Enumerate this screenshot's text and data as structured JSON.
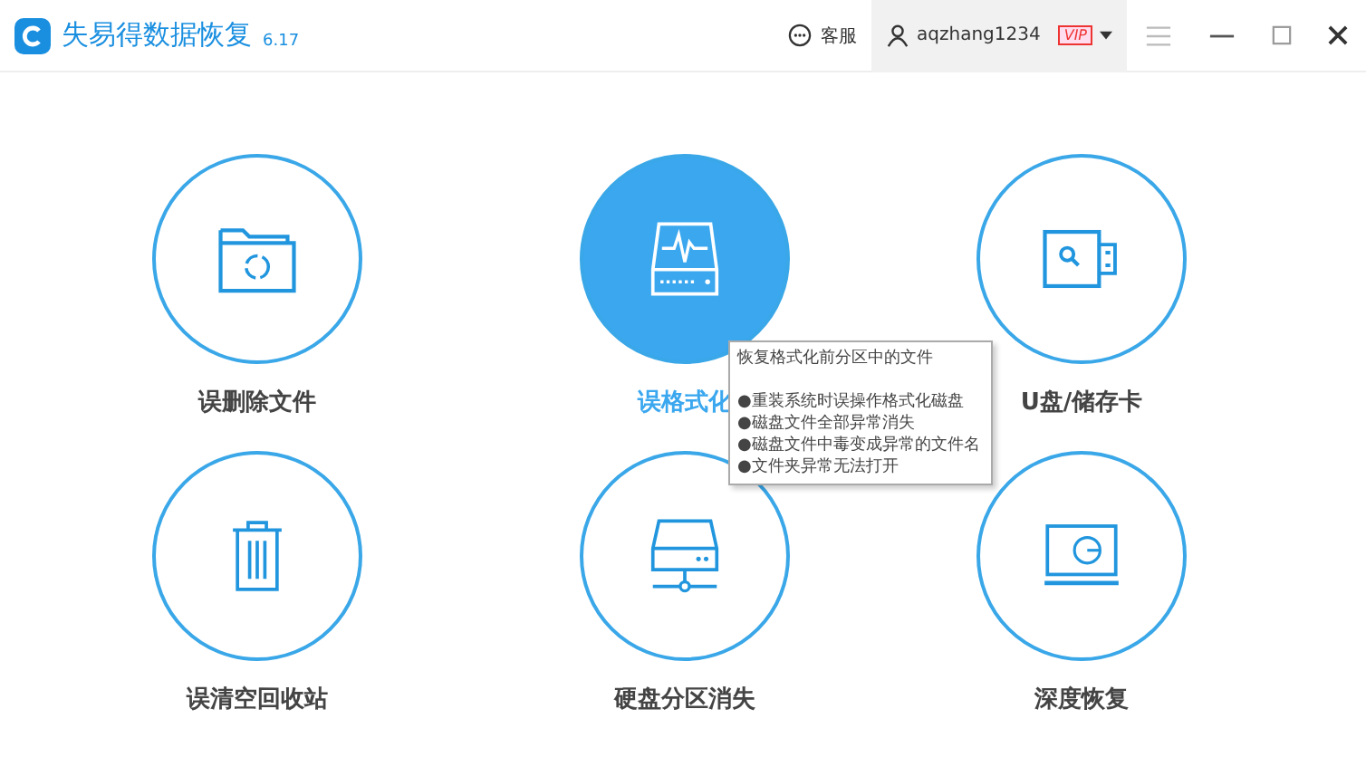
{
  "app": {
    "title": "失易得数据恢复",
    "version": "6.17"
  },
  "header": {
    "support": "客服",
    "username": "aqzhang1234",
    "badge": "VIP"
  },
  "modes": [
    {
      "kind": "folder",
      "label": "误删除文件",
      "selected": false
    },
    {
      "kind": "disk",
      "label": "误格式化",
      "selected": true
    },
    {
      "kind": "usb",
      "label": "U盘/储存卡",
      "selected": false
    },
    {
      "kind": "trash",
      "label": "误清空回收站",
      "selected": false
    },
    {
      "kind": "server",
      "label": "硬盘分区消失",
      "selected": false
    },
    {
      "kind": "monitor",
      "label": "深度恢复",
      "selected": false
    }
  ],
  "tooltip": {
    "title": "恢复格式化前分区中的文件",
    "lines": [
      "●重装系统时误操作格式化磁盘",
      "●磁盘文件全部异常消失",
      "●磁盘文件中毒变成异常的文件名",
      "●文件夹异常无法打开"
    ]
  }
}
